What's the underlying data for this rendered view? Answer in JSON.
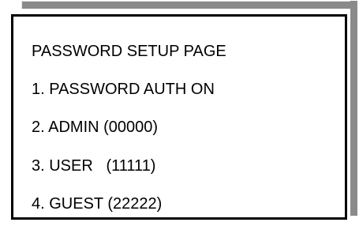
{
  "password_setup_menu": {
    "title": "PASSWORD SETUP PAGE",
    "items": [
      {
        "label": "1. PASSWORD AUTH ON"
      },
      {
        "label": "2. ADMIN (00000)"
      },
      {
        "label": "3. USER   (11111)"
      },
      {
        "label": "4. GUEST (22222)"
      }
    ]
  }
}
